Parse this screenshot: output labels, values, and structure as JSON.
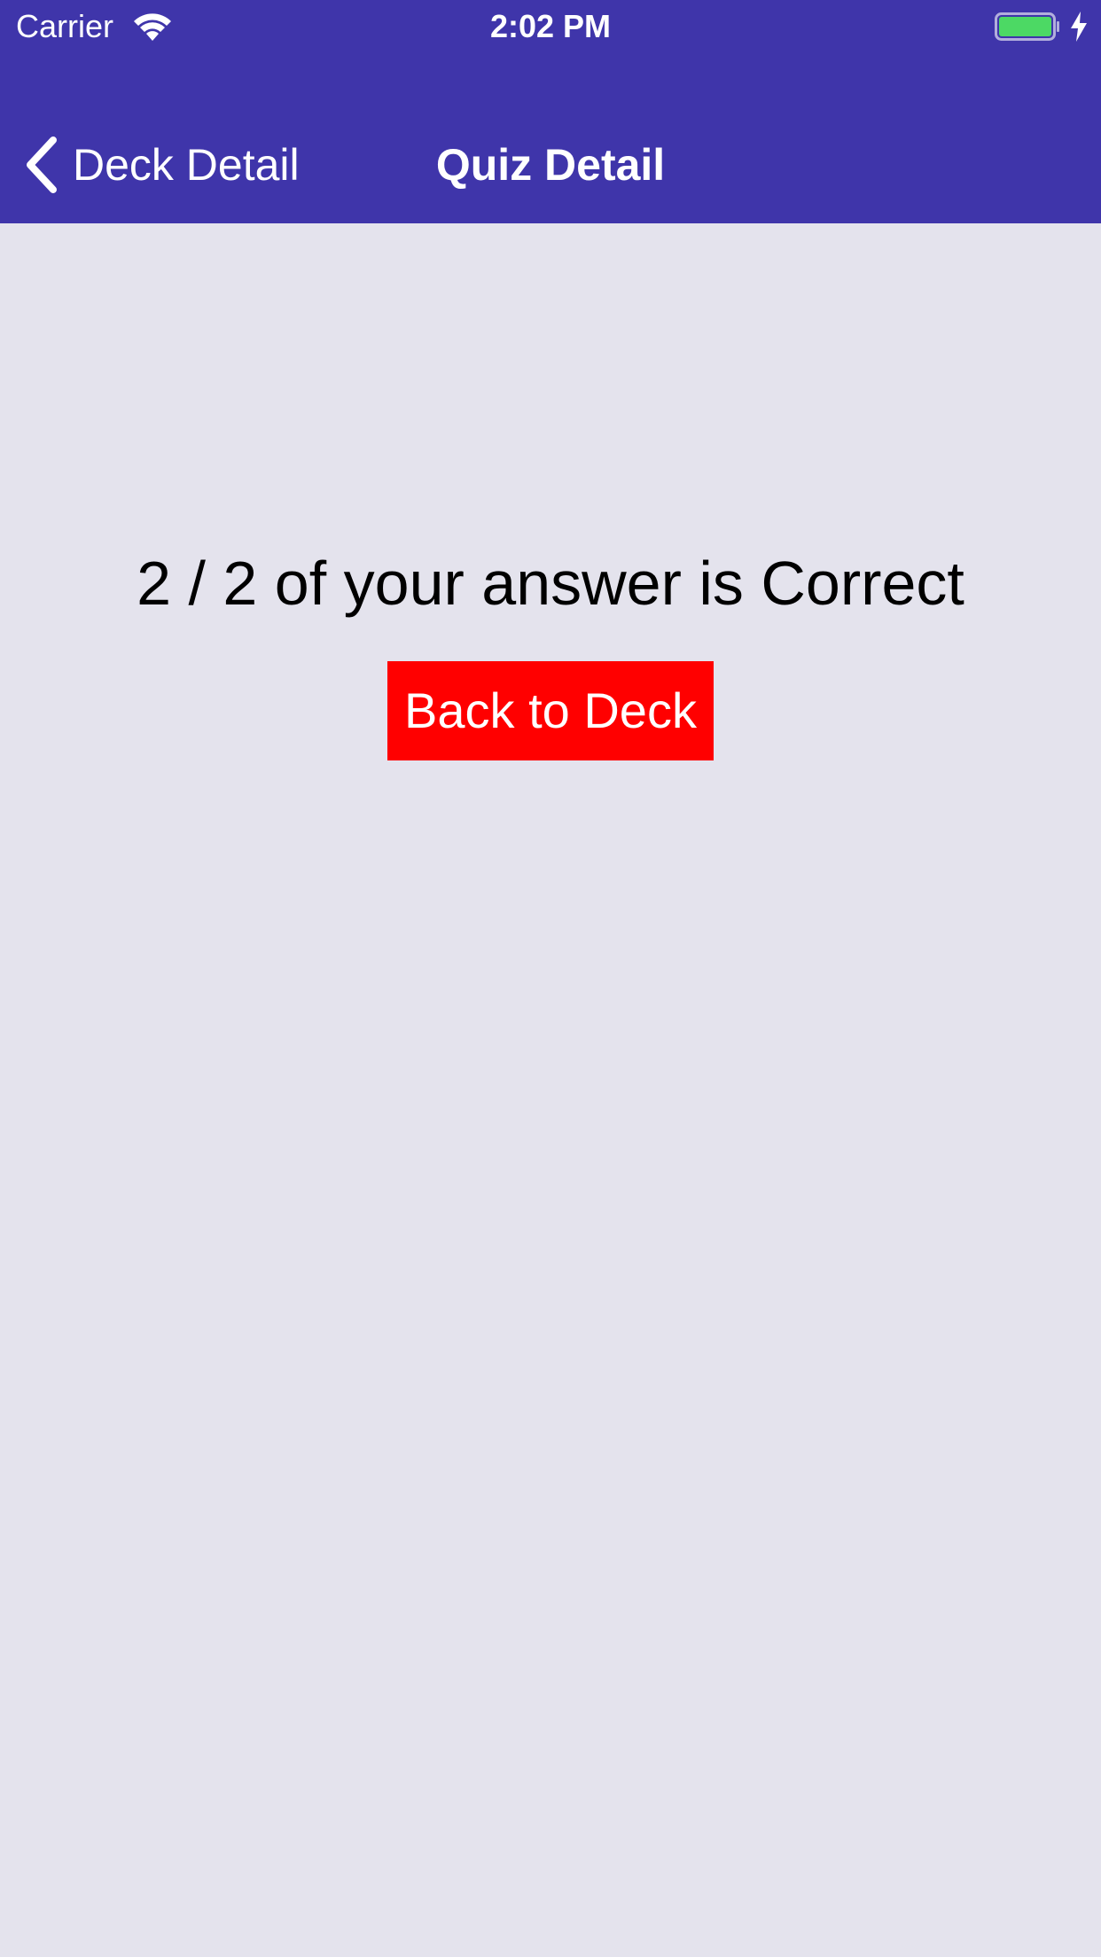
{
  "status_bar": {
    "carrier": "Carrier",
    "time": "2:02 PM",
    "wifi_icon": "wifi-icon",
    "battery_icon": "battery-icon",
    "charging_icon": "bolt-icon",
    "battery_level": 1.0,
    "battery_color": "#4cd964"
  },
  "nav": {
    "back_label": "Deck Detail",
    "back_icon": "chevron-left-icon",
    "title": "Quiz Detail"
  },
  "quiz_result": {
    "message": "2 / 2 of your answer is Correct",
    "button_label": "Back to Deck"
  },
  "colors": {
    "header_background": "#3f35aa",
    "page_background": "#e4e3ed",
    "button_background": "#ff0000",
    "button_text": "#ffffff"
  }
}
